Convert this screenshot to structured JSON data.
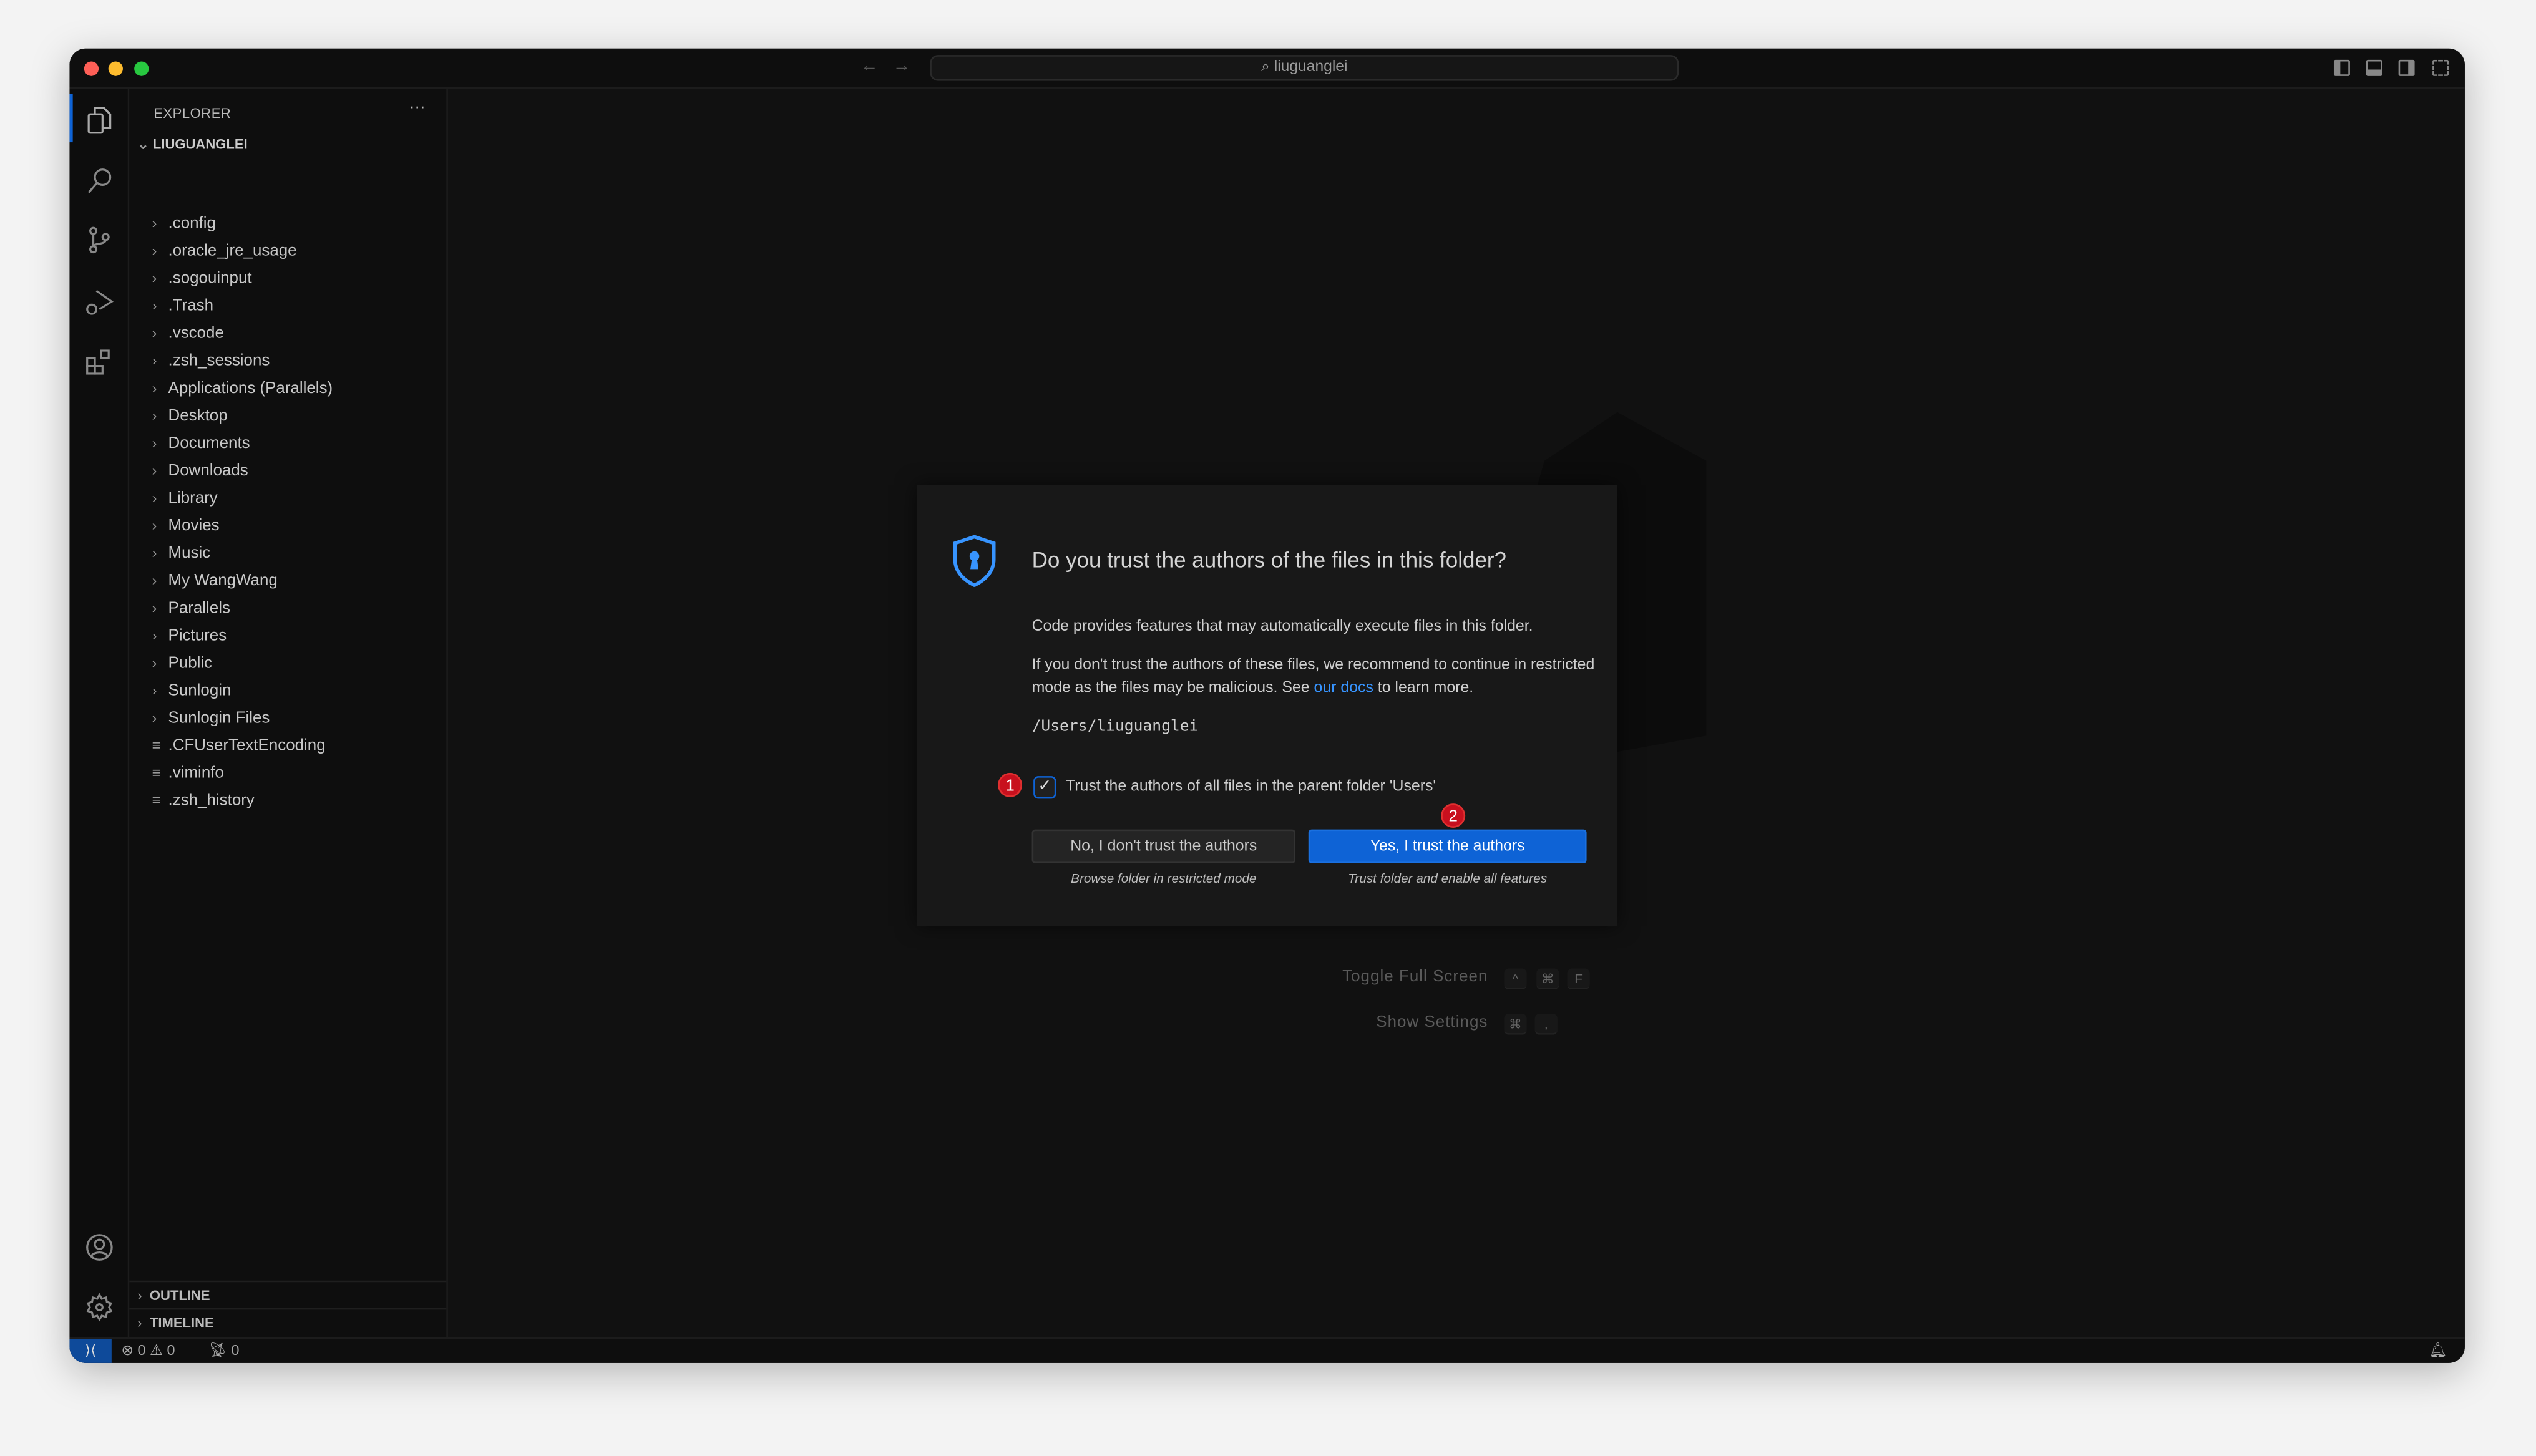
{
  "titlebar": {
    "search_text": "liuguanglei",
    "back": "←",
    "forward": "→"
  },
  "sidebar": {
    "header": "EXPLORER",
    "more": "···",
    "root": "LIUGUANGLEI",
    "items": [
      {
        "label": ".config",
        "type": "folder"
      },
      {
        "label": ".oracle_jre_usage",
        "type": "folder"
      },
      {
        "label": ".sogouinput",
        "type": "folder"
      },
      {
        "label": ".Trash",
        "type": "folder"
      },
      {
        "label": ".vscode",
        "type": "folder"
      },
      {
        "label": ".zsh_sessions",
        "type": "folder"
      },
      {
        "label": "Applications (Parallels)",
        "type": "folder"
      },
      {
        "label": "Desktop",
        "type": "folder"
      },
      {
        "label": "Documents",
        "type": "folder"
      },
      {
        "label": "Downloads",
        "type": "folder"
      },
      {
        "label": "Library",
        "type": "folder"
      },
      {
        "label": "Movies",
        "type": "folder"
      },
      {
        "label": "Music",
        "type": "folder"
      },
      {
        "label": "My WangWang",
        "type": "folder"
      },
      {
        "label": "Parallels",
        "type": "folder"
      },
      {
        "label": "Pictures",
        "type": "folder"
      },
      {
        "label": "Public",
        "type": "folder"
      },
      {
        "label": "Sunlogin",
        "type": "folder"
      },
      {
        "label": "Sunlogin Files",
        "type": "folder"
      },
      {
        "label": ".CFUserTextEncoding",
        "type": "file"
      },
      {
        "label": ".viminfo",
        "type": "file"
      },
      {
        "label": ".zsh_history",
        "type": "file"
      }
    ],
    "outline": "OUTLINE",
    "timeline": "TIMELINE"
  },
  "shortcuts": [
    {
      "label": "Toggle Full Screen",
      "keys": [
        "^",
        "⌘",
        "F"
      ]
    },
    {
      "label": "Show Settings",
      "keys": [
        "⌘",
        ","
      ]
    }
  ],
  "dialog": {
    "title": "Do you trust the authors of the files in this folder?",
    "p1": "Code provides features that may automatically execute files in this folder.",
    "p2_before": "If you don't trust the authors of these files, we recommend to continue in restricted mode as the files may be malicious. See ",
    "p2_link": "our docs",
    "p2_after": " to learn more.",
    "path": "/Users/liuguanglei",
    "checkbox_label": "Trust the authors of all files in the parent folder 'Users'",
    "checkbox_checked": true,
    "no_button": "No, I don't trust the authors",
    "no_sub": "Browse folder in restricted mode",
    "yes_button": "Yes, I trust the authors",
    "yes_sub": "Trust folder and enable all features",
    "badge1": "1",
    "badge2": "2"
  },
  "status": {
    "errors": "0",
    "warnings": "0",
    "ports": "0"
  },
  "colors": {
    "accent": "#0e63d6",
    "badge": "#c8101e",
    "link": "#3794ff"
  }
}
